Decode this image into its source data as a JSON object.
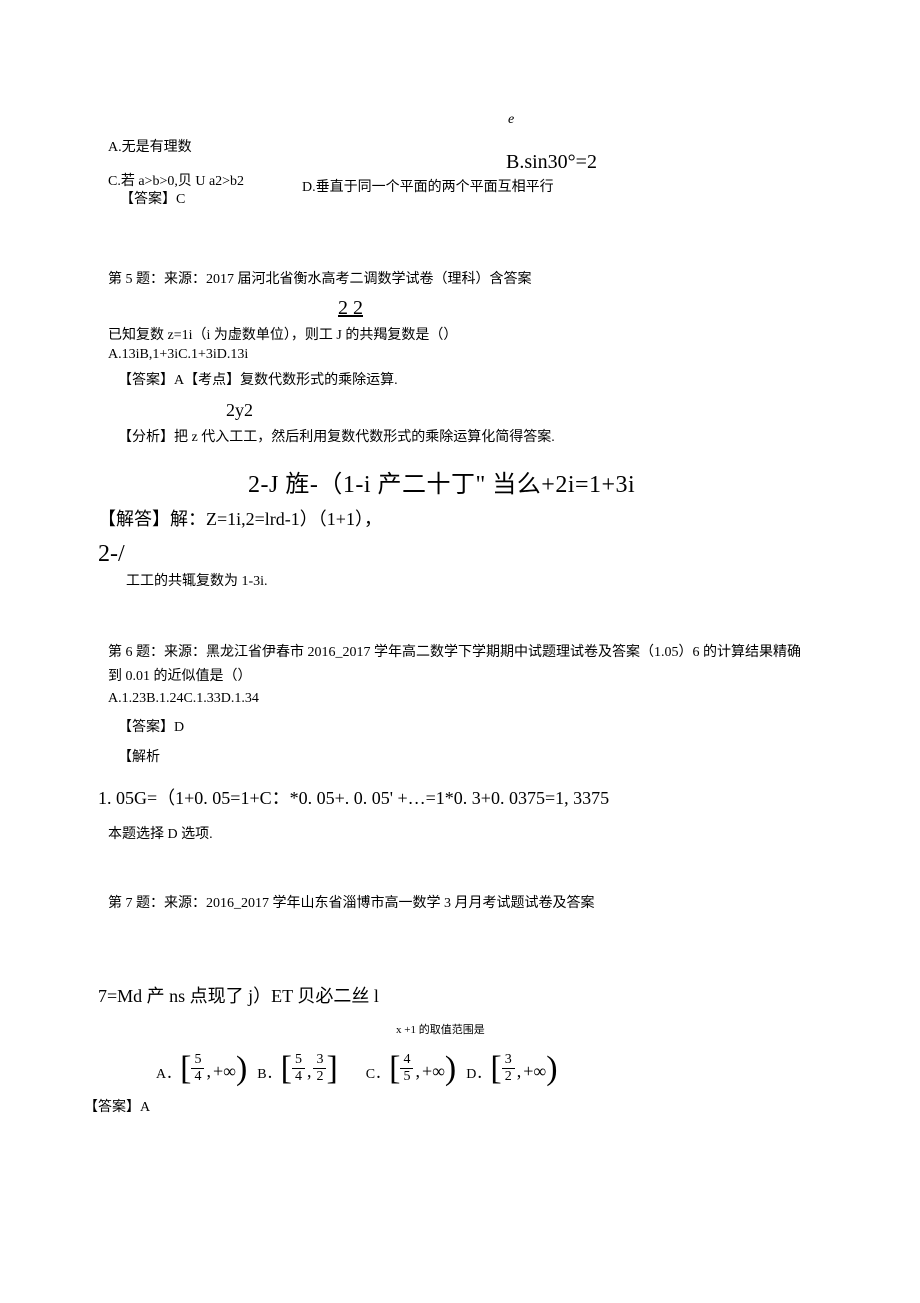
{
  "e_letter": "e",
  "opt_a": "A.无是有理数",
  "opt_b": "B.sin30°=2",
  "opt_c": "C.若 a>b>0,贝 U a2>b2",
  "opt_d": "D.垂直于同一个平面的两个平面互相平行",
  "ans1": "【答案】C",
  "q5_source": "第 5 题：来源：2017 届河北省衡水高考二调数学试卷（理科）含答案",
  "q5_frac": "2    2",
  "q5_stem": "已知复数 z=1i（i 为虚数单位），则工 J 的共羯复数是（）",
  "q5_opts": "A.13iB,1+3iC.1+3iD.13i",
  "q5_ans": "【答案】A【考点】复数代数形式的乘除运算.",
  "q5_frac2": "2y2",
  "q5_fx_line": "【分析】把 z 代入工工，然后利用复数代数形式的乘除运算化简得答案.",
  "q5_eq_right": "2-J 旌-（1-i 产二十丁\" 当么+2i=1+3i",
  "q5_eq_left": "【解答】解：Z=1i,2=lrd-1）（1+1），",
  "q5_twoj": "2-/",
  "q5_conc": "工工的共辄复数为 1-3i.",
  "q6_source": "第 6 题：来源：黑龙江省伊春市 2016_2017 学年高二数学下学期期中试题理试卷及答案（1.05）6 的计算结果精确到 0.01 的近似值是（）",
  "q6_opts": "A.1.23B.1.24C.1.33D.1.34",
  "q6_ans": "【答案】D",
  "q6_jiexi": "【解析",
  "q6_calc": "1. 05G=（1+0. 05=1+C：*0. 05+. 0. 05' +…=1*0. 3+0. 0375=1, 3375",
  "q6_pick": "本题选择 D 选项.",
  "q7_source": "第 7 题：来源：2016_2017 学年山东省淄博市高一数学 3 月月考试题试卷及答案",
  "q7_line": "7=Md 产 ns 点现了 j）ET 贝必二丝 l",
  "q7_range": "x +1 的取值范围是",
  "q7_optA": "A．",
  "q7_optB": "B．",
  "q7_optC": "C．",
  "q7_optD": "D．",
  "q7_ans": "【答案】A",
  "frac_54_n": "5",
  "frac_54_d": "4",
  "frac_32_n": "3",
  "frac_32_d": "2",
  "frac_45_n": "4",
  "frac_45_d": "5",
  "inf": "+∞",
  "comma": ",",
  "rb": ")",
  "rb2": "]"
}
